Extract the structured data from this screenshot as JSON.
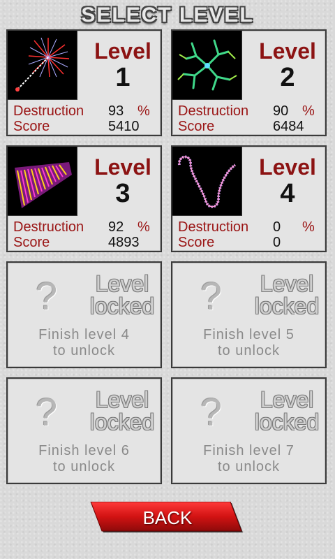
{
  "title": "SELECT LEVEL",
  "levels": [
    {
      "word": "Level",
      "number": "1",
      "destruction_label": "Destruction",
      "destruction": "93",
      "pct": "%",
      "score_label": "Score",
      "score": "5410",
      "thumbnail": "starburst"
    },
    {
      "word": "Level",
      "number": "2",
      "destruction_label": "Destruction",
      "destruction": "90",
      "pct": "%",
      "score_label": "Score",
      "score": "6484",
      "thumbnail": "branching-crystal"
    },
    {
      "word": "Level",
      "number": "3",
      "destruction_label": "Destruction",
      "destruction": "92",
      "pct": "%",
      "score_label": "Score",
      "score": "4893",
      "thumbnail": "striped-ribbon"
    },
    {
      "word": "Level",
      "number": "4",
      "destruction_label": "Destruction",
      "destruction": "0",
      "pct": "%",
      "score_label": "Score",
      "score": "0",
      "thumbnail": "curly-chain"
    }
  ],
  "locked": [
    {
      "mark": "?",
      "line1": "Level",
      "line2": "locked",
      "msg1": "Finish level 4",
      "msg2": "to unlock"
    },
    {
      "mark": "?",
      "line1": "Level",
      "line2": "locked",
      "msg1": "Finish level 5",
      "msg2": "to unlock"
    },
    {
      "mark": "?",
      "line1": "Level",
      "line2": "locked",
      "msg1": "Finish level 6",
      "msg2": "to unlock"
    },
    {
      "mark": "?",
      "line1": "Level",
      "line2": "locked",
      "msg1": "Finish level 7",
      "msg2": "to unlock"
    }
  ],
  "back_label": "BACK",
  "colors": {
    "accent": "#8c1313",
    "button": "#d31313"
  }
}
